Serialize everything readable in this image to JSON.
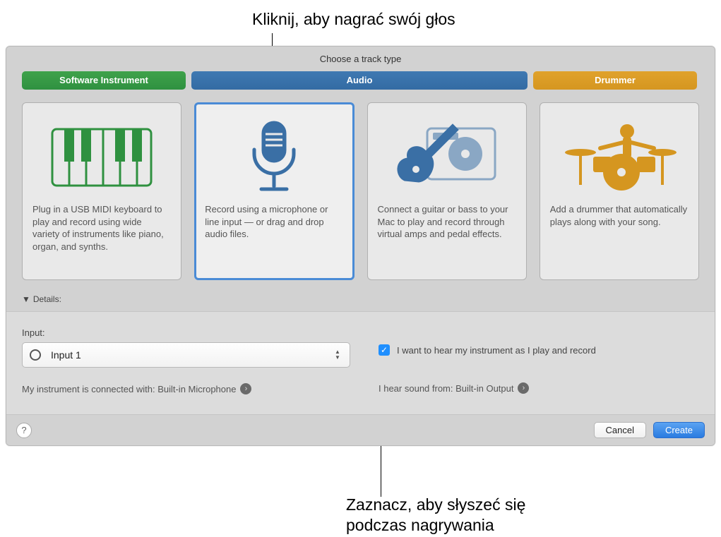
{
  "callouts": {
    "top": "Kliknij, aby nagrać swój głos",
    "bottom_line1": "Zaznacz, aby słyszeć się",
    "bottom_line2": "podczas nagrywania"
  },
  "panel": {
    "title": "Choose a track type",
    "tabs": {
      "software": "Software Instrument",
      "audio": "Audio",
      "drummer": "Drummer"
    },
    "cards": {
      "software": "Plug in a USB MIDI keyboard to play and record using wide variety of instruments like piano, organ, and synths.",
      "mic": "Record using a microphone or line input — or drag and drop audio files.",
      "guitar": "Connect a guitar or bass to your Mac to play and record through virtual amps and pedal effects.",
      "drummer": "Add a drummer that automatically plays along with your song."
    },
    "details_label": "Details:",
    "input": {
      "label": "Input:",
      "value": "Input 1",
      "connection_text": "My instrument is connected with: Built-in Microphone"
    },
    "monitor": {
      "checkbox_label": "I want to hear my instrument as I play and record",
      "checked": true,
      "output_text": "I hear sound from: Built-in Output"
    },
    "footer": {
      "help": "?",
      "cancel": "Cancel",
      "create": "Create"
    }
  }
}
